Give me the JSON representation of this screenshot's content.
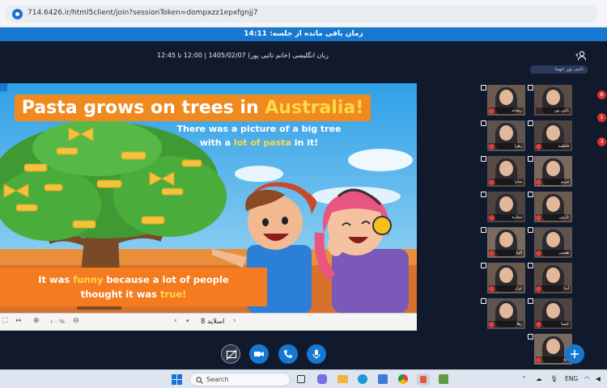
{
  "browser": {
    "url": "714.6426.ir/html5client/join?sessionToken=dompxzz1epxfgnjj7"
  },
  "timer": {
    "text": "زمان باقی مانده از جلسه: 14:11"
  },
  "meeting": {
    "title": "زبان انگلیسی (خانم نائبی پور) 1405/02/07 | 12:00 تا 12:45"
  },
  "sidebar": {
    "search_placeholder": "نائبی پور جهینا"
  },
  "slide": {
    "headline_prefix": "Pasta grows on trees in ",
    "headline_highlight": "Australia!",
    "caption_top_1": "There was a picture of a big tree",
    "caption_top_2": "with a ",
    "caption_top_highlight": "lot of pasta",
    "caption_top_3": " in it!",
    "caption_bottom_1": "It was ",
    "caption_bottom_highlight1": "funny",
    "caption_bottom_2": " because a lot of people",
    "caption_bottom_3": "thought it was ",
    "caption_bottom_highlight2": "true!",
    "slide_label": "اسلاید 8",
    "zoom_label": "۱۰۰%"
  },
  "participants": [
    {
      "name": "نائبی پور",
      "mic": false
    },
    {
      "name": "ریحانه",
      "mic": true
    },
    {
      "name": "فاطمه",
      "mic": true
    },
    {
      "name": "زهرا",
      "mic": true
    },
    {
      "name": "مریم",
      "mic": true
    },
    {
      "name": "سارا",
      "mic": true
    },
    {
      "name": "نازنین",
      "mic": true
    },
    {
      "name": "ستاره",
      "mic": true
    },
    {
      "name": "هستی",
      "mic": true
    },
    {
      "name": "الینا",
      "mic": true
    },
    {
      "name": "آیدا",
      "mic": true
    },
    {
      "name": "غزل",
      "mic": true
    },
    {
      "name": "کیمیا",
      "mic": true
    },
    {
      "name": "رها",
      "mic": true
    },
    {
      "name": "دنیا",
      "mic": true
    }
  ],
  "notifications": [
    "8",
    "1",
    "3"
  ],
  "taskbar": {
    "search_label": "Search",
    "lang": "ENG"
  },
  "colors": {
    "accent": "#1778d2",
    "header_bg": "#111a2c",
    "orange": "#f08a1e",
    "mute": "#e23b3b"
  }
}
